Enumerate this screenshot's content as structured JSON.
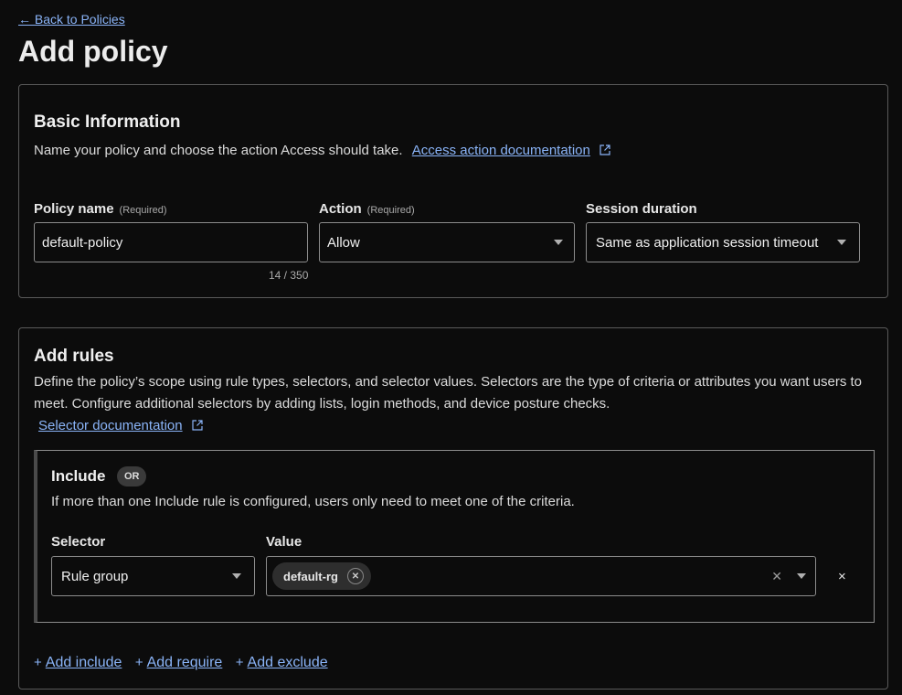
{
  "nav": {
    "back_label": "← Back to Policies"
  },
  "page": {
    "title": "Add policy"
  },
  "basic_info": {
    "title": "Basic Information",
    "description": "Name your policy and choose the action Access should take.",
    "doc_link": "Access action documentation",
    "fields": {
      "policy_name": {
        "label": "Policy name",
        "required": "(Required)",
        "value": "default-policy",
        "counter": "14 / 350"
      },
      "action": {
        "label": "Action",
        "required": "(Required)",
        "value": "Allow"
      },
      "session_duration": {
        "label": "Session duration",
        "value": "Same as application session timeout"
      }
    }
  },
  "rules": {
    "title": "Add rules",
    "description": "Define the policy’s scope using rule types, selectors, and selector values. Selectors are the type of criteria or attributes you want users to meet. Configure additional selectors by adding lists, login methods, and device posture checks.",
    "doc_link": "Selector documentation",
    "include": {
      "title": "Include",
      "badge": "OR",
      "description": "If more than one Include rule is configured, users only need to meet one of the criteria.",
      "selector_label": "Selector",
      "selector_value": "Rule group",
      "value_label": "Value",
      "value_chip": "default-rg",
      "remove_symbol": "×"
    },
    "actions": {
      "add_include": "Add include",
      "add_require": "Add require",
      "add_exclude": "Add exclude"
    }
  },
  "icons": [
    "external-link-icon",
    "chevron-down-icon",
    "close-icon",
    "plus-icon"
  ],
  "colors": {
    "background": "#0c0c0c",
    "link": "#8ab4f8",
    "border": "#5a5a5a"
  }
}
